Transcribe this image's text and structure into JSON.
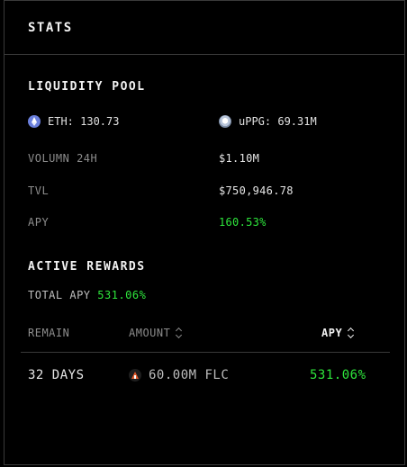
{
  "header": {
    "title": "STATS"
  },
  "liquidity_pool": {
    "title": "LIQUIDITY POOL",
    "tokens": [
      {
        "icon": "eth-icon",
        "text": "ETH: 130.73"
      },
      {
        "icon": "uppg-icon",
        "text": "uPPG: 69.31M"
      }
    ],
    "stats": [
      {
        "label": "VOLUMN 24H",
        "value": "$1.10M"
      },
      {
        "label": "TVL",
        "value": "$750,946.78"
      },
      {
        "label": "APY",
        "value": "160.53%",
        "color": "#2ee63c"
      }
    ]
  },
  "active_rewards": {
    "title": "ACTIVE REWARDS",
    "total_apy_label": "TOTAL APY",
    "total_apy_value": "531.06%",
    "table": {
      "columns": [
        {
          "label": "REMAIN",
          "sortable": false,
          "active": false
        },
        {
          "label": "AMOUNT",
          "sortable": true,
          "active": false
        },
        {
          "label": "APY",
          "sortable": true,
          "active": true
        }
      ],
      "rows": [
        {
          "remain": "32 DAYS",
          "amount": "60.00M FLC",
          "token_icon": "flc-icon",
          "apy": "531.06%"
        }
      ]
    }
  },
  "colors": {
    "background": "#000000",
    "border": "#3a3a3a",
    "accent_green": "#2ee63c",
    "muted_text": "#8c8c8c"
  }
}
